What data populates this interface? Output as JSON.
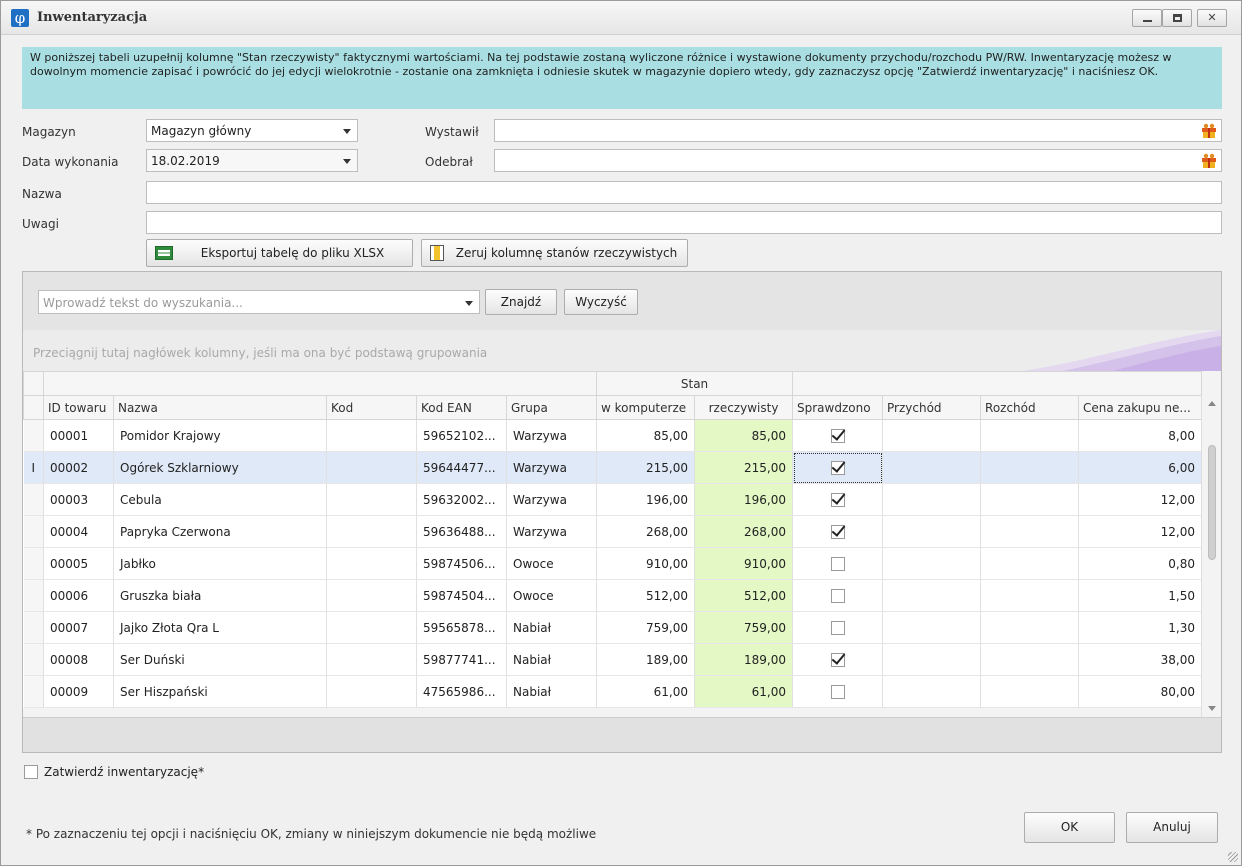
{
  "window": {
    "title": "Inwentaryzacja",
    "icon": "phi-icon",
    "controls": [
      "minimize",
      "maximize",
      "close"
    ]
  },
  "info_text": "W poniższej tabeli uzupełnij kolumnę \"Stan rzeczywisty\" faktycznymi wartościami. Na tej podstawie zostaną wyliczone różnice i wystawione dokumenty przychodu/rozchodu PW/RW. Inwentaryzację możesz w dowolnym momencie zapisać i powrócić do jej edycji wielokrotnie - zostanie ona zamknięta i odniesie skutek w magazynie dopiero wtedy, gdy zaznaczysz opcję \"Zatwierdź inwentaryzację\" i naciśniesz OK.",
  "form": {
    "magazyn_label": "Magazyn",
    "magazyn_value": "Magazyn główny",
    "data_label": "Data wykonania",
    "data_value": "18.02.2019",
    "wystawil_label": "Wystawił",
    "wystawil_value": "",
    "odebral_label": "Odebrał",
    "odebral_value": "",
    "nazwa_label": "Nazwa",
    "nazwa_value": "",
    "uwagi_label": "Uwagi",
    "uwagi_value": ""
  },
  "toolbar": {
    "export_label": "Eksportuj tabelę do pliku XLSX",
    "reset_label": "Zeruj kolumnę stanów rzeczywistych"
  },
  "search": {
    "placeholder": "Wprowadź tekst do wyszukania...",
    "find_label": "Znajdź",
    "clear_label": "Wyczyść"
  },
  "group_hint": "Przeciągnij tutaj nagłówek kolumny, jeśli ma ona być podstawą grupowania",
  "table": {
    "band_stan": "Stan",
    "columns": {
      "id": "ID towaru",
      "nazwa": "Nazwa",
      "kod": "Kod",
      "ean": "Kod EAN",
      "grupa": "Grupa",
      "komputer": "w komputerze",
      "rzeczywisty": "rzeczywisty",
      "sprawdzono": "Sprawdzono",
      "przychod": "Przychód",
      "rozchod": "Rozchód",
      "cena": "Cena zakupu ne..."
    },
    "rows": [
      {
        "id": "00001",
        "nazwa": "Pomidor Krajowy",
        "kod": "",
        "ean": "59652102...",
        "grupa": "Warzywa",
        "komputer": "85,00",
        "rzeczywisty": "85,00",
        "sprawdzono": true,
        "przychod": "",
        "rozchod": "",
        "cena": "8,00"
      },
      {
        "id": "00002",
        "nazwa": "Ogórek Szklarniowy",
        "kod": "",
        "ean": "59644477...",
        "grupa": "Warzywa",
        "komputer": "215,00",
        "rzeczywisty": "215,00",
        "sprawdzono": true,
        "przychod": "",
        "rozchod": "",
        "cena": "6,00"
      },
      {
        "id": "00003",
        "nazwa": "Cebula",
        "kod": "",
        "ean": "59632002...",
        "grupa": "Warzywa",
        "komputer": "196,00",
        "rzeczywisty": "196,00",
        "sprawdzono": true,
        "przychod": "",
        "rozchod": "",
        "cena": "12,00"
      },
      {
        "id": "00004",
        "nazwa": "Papryka Czerwona",
        "kod": "",
        "ean": "59636488...",
        "grupa": "Warzywa",
        "komputer": "268,00",
        "rzeczywisty": "268,00",
        "sprawdzono": true,
        "przychod": "",
        "rozchod": "",
        "cena": "12,00"
      },
      {
        "id": "00005",
        "nazwa": "Jabłko",
        "kod": "",
        "ean": "59874506...",
        "grupa": "Owoce",
        "komputer": "910,00",
        "rzeczywisty": "910,00",
        "sprawdzono": false,
        "przychod": "",
        "rozchod": "",
        "cena": "0,80"
      },
      {
        "id": "00006",
        "nazwa": "Gruszka biała",
        "kod": "",
        "ean": "59874504...",
        "grupa": "Owoce",
        "komputer": "512,00",
        "rzeczywisty": "512,00",
        "sprawdzono": false,
        "przychod": "",
        "rozchod": "",
        "cena": "1,50"
      },
      {
        "id": "00007",
        "nazwa": "Jajko Złota Qra L",
        "kod": "",
        "ean": "59565878...",
        "grupa": "Nabiał",
        "komputer": "759,00",
        "rzeczywisty": "759,00",
        "sprawdzono": false,
        "przychod": "",
        "rozchod": "",
        "cena": "1,30"
      },
      {
        "id": "00008",
        "nazwa": "Ser Duński",
        "kod": "",
        "ean": "59877741...",
        "grupa": "Nabiał",
        "komputer": "189,00",
        "rzeczywisty": "189,00",
        "sprawdzono": true,
        "przychod": "",
        "rozchod": "",
        "cena": "38,00"
      },
      {
        "id": "00009",
        "nazwa": "Ser Hiszpański",
        "kod": "",
        "ean": "47565986...",
        "grupa": "Nabiał",
        "komputer": "61,00",
        "rzeczywisty": "61,00",
        "sprawdzono": false,
        "przychod": "",
        "rozchod": "",
        "cena": "80,00"
      }
    ],
    "selected_row_index": 1,
    "row_indicator": "I"
  },
  "confirm_label": "Zatwierdź inwentaryzację*",
  "confirm_checked": false,
  "note": "* Po zaznaczeniu tej opcji i naciśnięciu OK, zmiany w niniejszym dokumencie nie będą możliwe",
  "buttons": {
    "ok": "OK",
    "cancel": "Anuluj"
  },
  "colors": {
    "info_bg": "#a9dfe3",
    "rzeczywisty_bg": "#e3f8c4",
    "selected_row_bg": "#e0e9f7"
  }
}
